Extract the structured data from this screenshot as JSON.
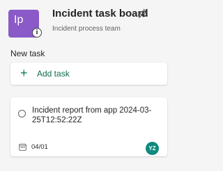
{
  "header": {
    "avatar_initials": "Ip",
    "avatar_color": "#8a5ac8",
    "title": "Incident task board",
    "subtitle": "Incident process team",
    "pin_icon": "pin-icon",
    "info_icon": "info-icon"
  },
  "section": {
    "label": "New task"
  },
  "add_task": {
    "label": "Add task",
    "icon": "plus-icon",
    "accent": "#0f7b5c"
  },
  "task": {
    "title": "Incident report from app 2024-03-25T12:52:22Z",
    "due_date": "04/01",
    "assignee_initials": "YZ",
    "assignee_color": "#0e8a7e"
  }
}
